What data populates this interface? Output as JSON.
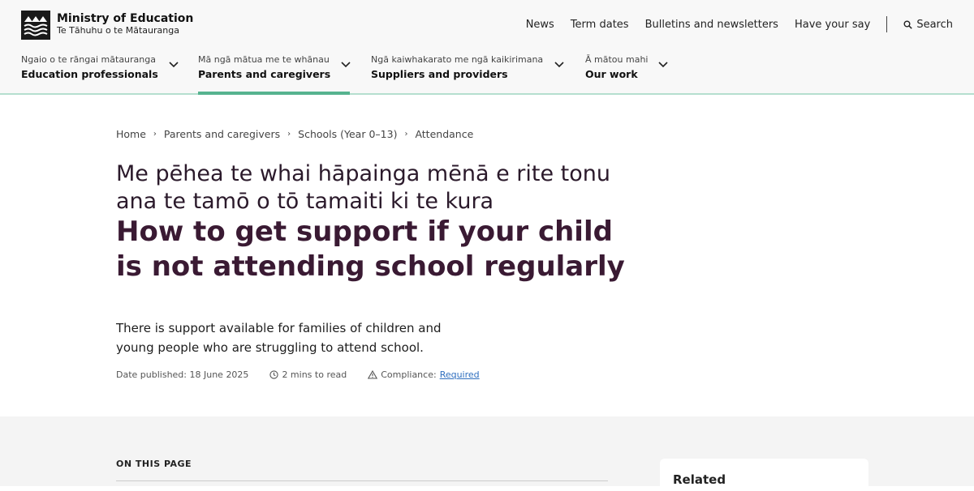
{
  "header": {
    "logo_title": "Ministry of Education",
    "logo_subtitle": "Te Tāhuhu o te Mātauranga",
    "utility_links": [
      "News",
      "Term dates",
      "Bulletins and newsletters",
      "Have your say"
    ],
    "search_label": "Search"
  },
  "main_nav": [
    {
      "maori": "Ngaio o te rāngai mātauranga",
      "label": "Education professionals"
    },
    {
      "maori": "Mā ngā mātua me te whānau",
      "label": "Parents and caregivers"
    },
    {
      "maori": "Ngā kaiwhakarato me ngā kaikirimana",
      "label": "Suppliers and providers"
    },
    {
      "maori": "Ā mātou mahi",
      "label": "Our work"
    }
  ],
  "breadcrumb": [
    "Home",
    "Parents and caregivers",
    "Schools (Year 0–13)",
    "Attendance"
  ],
  "page": {
    "title_maori": "Me pēhea te whai hāpainga mēnā e rite tonu ana te tamō o tō tamaiti ki te kura",
    "title_english": "How to get support if your child is not attending school regularly",
    "intro": "There is support available for families of children and young people who are struggling to attend school.",
    "date_published": "Date published: 18 June 2025",
    "read_time": "2 mins to read",
    "compliance_label": "Compliance:",
    "compliance_value": "Required"
  },
  "on_this_page": {
    "heading": "ON THIS PAGE"
  },
  "related": {
    "heading": "Related"
  },
  "colors": {
    "accent": "#56b38f",
    "title": "#3a1a33",
    "link": "#2f6fbf"
  }
}
